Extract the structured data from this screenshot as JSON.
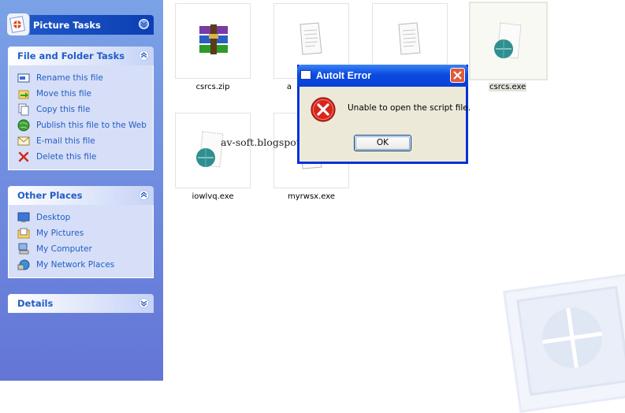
{
  "task_pane": {
    "picture_tasks": {
      "title": "Picture Tasks"
    },
    "file_folder_tasks": {
      "title": "File and Folder Tasks",
      "items": [
        {
          "label": "Rename this file",
          "icon": "rename-icon"
        },
        {
          "label": "Move this file",
          "icon": "move-icon"
        },
        {
          "label": "Copy this file",
          "icon": "copy-icon"
        },
        {
          "label": "Publish this file to the Web",
          "icon": "globe-icon"
        },
        {
          "label": "E-mail this file",
          "icon": "email-icon"
        },
        {
          "label": "Delete this file",
          "icon": "delete-icon"
        }
      ]
    },
    "other_places": {
      "title": "Other Places",
      "items": [
        {
          "label": "Desktop",
          "icon": "desktop-icon"
        },
        {
          "label": "My Pictures",
          "icon": "pictures-folder-icon"
        },
        {
          "label": "My Computer",
          "icon": "computer-icon"
        },
        {
          "label": "My Network Places",
          "icon": "network-icon"
        }
      ]
    },
    "details": {
      "title": "Details"
    }
  },
  "files": [
    {
      "name": "csrcs.zip",
      "icon": "winrar-archive-icon"
    },
    {
      "name": "a",
      "icon": "text-file-icon"
    },
    {
      "name": "",
      "icon": "text-file-icon"
    },
    {
      "name": "csrcs.exe",
      "icon": "exe-file-icon",
      "selected": true
    },
    {
      "name": "iowlvq.exe",
      "icon": "exe-file-icon"
    },
    {
      "name": "myrwsx.exe",
      "icon": "text-file-icon"
    }
  ],
  "watermark_text": "av-soft.blogspot.com",
  "dialog": {
    "title": "AutoIt Error",
    "message": "Unable to open the script file.",
    "ok_label": "OK",
    "icon": "error-icon"
  },
  "colors": {
    "pane_gradient_top": "#7ba2e7",
    "pane_gradient_bottom": "#6375d6",
    "link_blue": "#215dc6",
    "titlebar_blue": "#0b4be0",
    "error_red": "#d8261c"
  }
}
